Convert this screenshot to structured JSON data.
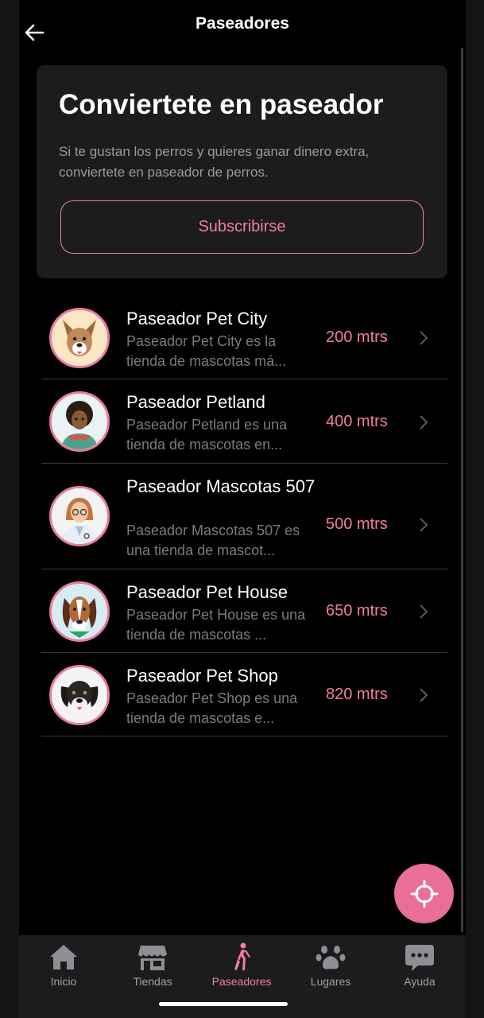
{
  "header": {
    "title": "Paseadores"
  },
  "promo": {
    "title": "Conviertete en paseador",
    "description": "Si te gustan los perros y quieres ganar dinero extra, conviertete en paseador de perros.",
    "button_label": "Subscribirse"
  },
  "walkers": [
    {
      "name": "Paseador Pet City",
      "description": "Paseador Pet City es la tienda de mascotas má...",
      "distance": "200 mtrs",
      "avatar": "dog-avatar-icon"
    },
    {
      "name": "Paseador Petland",
      "description": "Paseador Petland es una tienda de mascotas en...",
      "distance": "400 mtrs",
      "avatar": "person-avatar-icon"
    },
    {
      "name": "Paseador Mascotas 507",
      "description": "Paseador Mascotas 507 es una tienda de mascot...",
      "distance": "500 mtrs",
      "avatar": "vet-avatar-icon"
    },
    {
      "name": "Paseador Pet House",
      "description": "Paseador Pet House es una tienda de mascotas ...",
      "distance": "650 mtrs",
      "avatar": "basset-avatar-icon"
    },
    {
      "name": "Paseador Pet Shop",
      "description": "Paseador Pet Shop es una tienda de mascotas e...",
      "distance": "820 mtrs",
      "avatar": "black-dog-avatar-icon"
    }
  ],
  "tabs": [
    {
      "label": "Inicio",
      "icon": "home-icon"
    },
    {
      "label": "Tiendas",
      "icon": "store-icon"
    },
    {
      "label": "Paseadores",
      "icon": "walker-icon",
      "active": true
    },
    {
      "label": "Lugares",
      "icon": "paw-icon"
    },
    {
      "label": "Ayuda",
      "icon": "chat-icon"
    }
  ],
  "colors": {
    "accent": "#f07ea0",
    "fab": "#ea6f97",
    "card": "#1c1c1e",
    "background": "#000000"
  }
}
